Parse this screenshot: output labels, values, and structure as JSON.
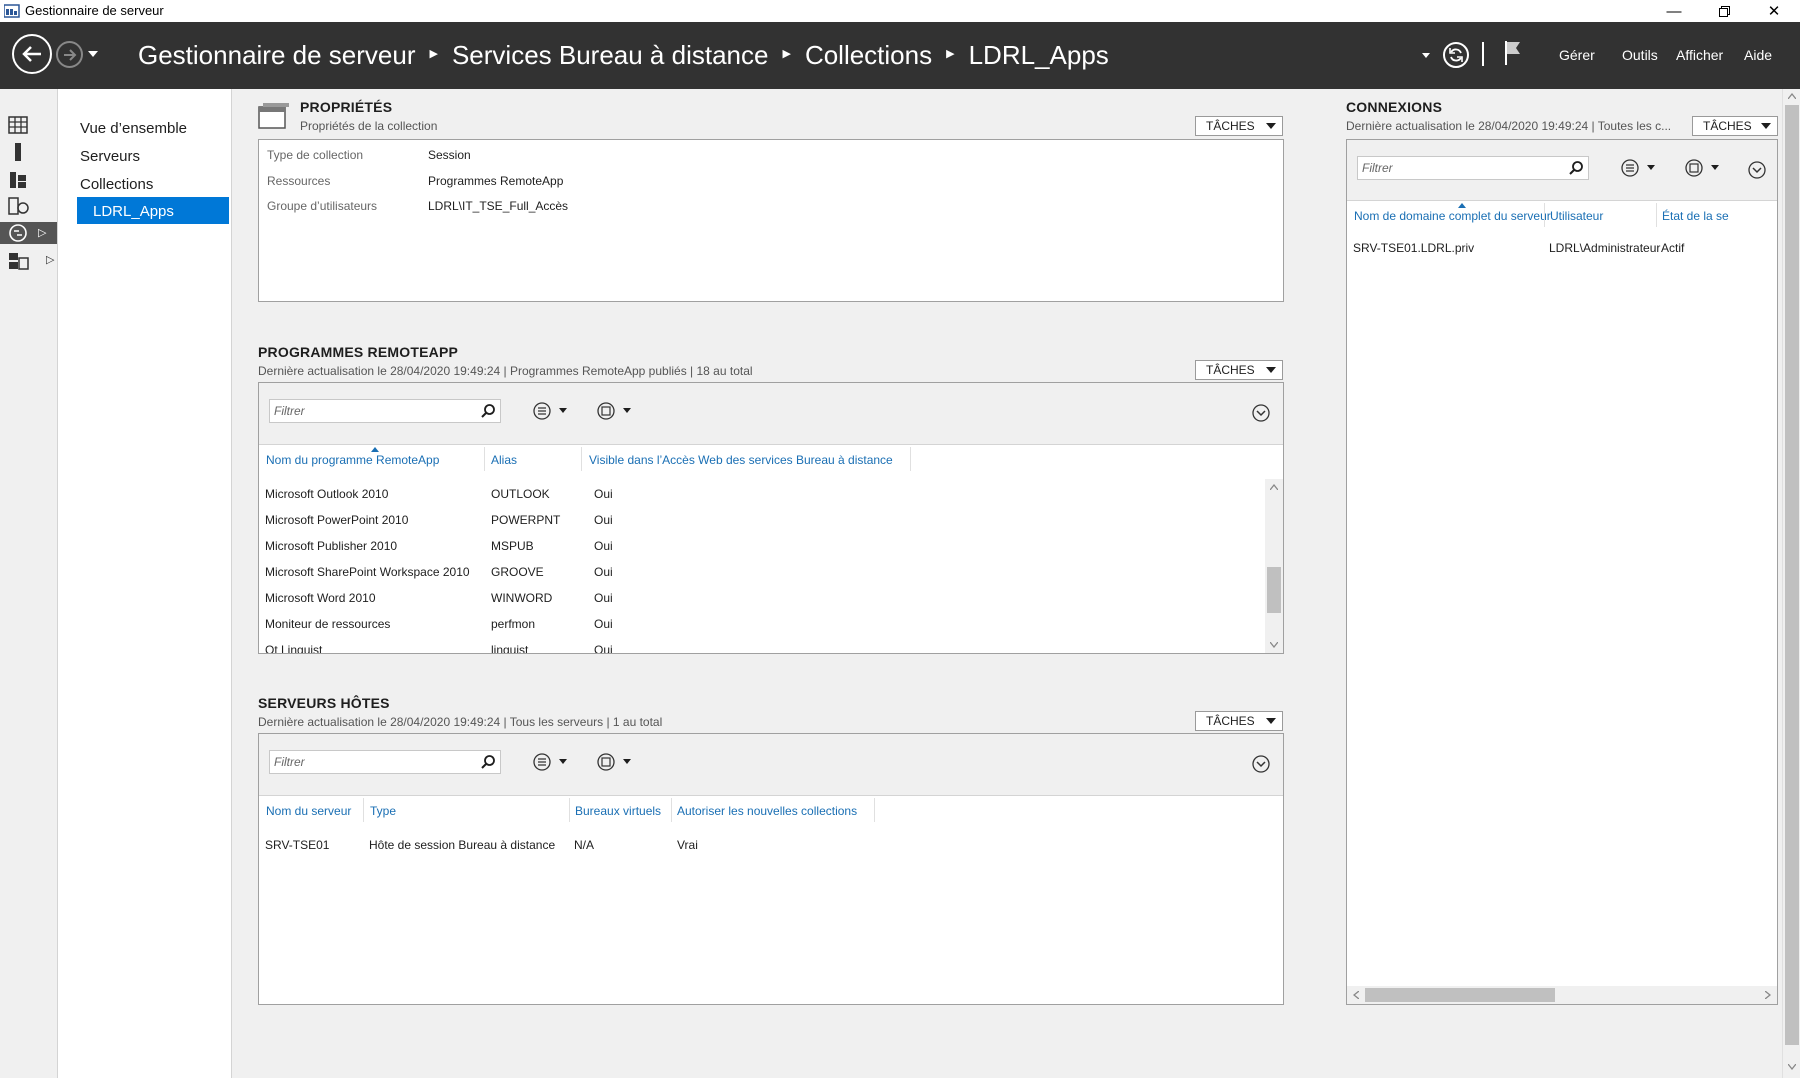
{
  "window": {
    "title": "Gestionnaire de serveur"
  },
  "header": {
    "breadcrumb": [
      "Gestionnaire de serveur",
      "Services Bureau à distance",
      "Collections",
      "LDRL_Apps"
    ],
    "menu": {
      "manage": "Gérer",
      "tools": "Outils",
      "view": "Afficher",
      "help": "Aide"
    }
  },
  "nav": {
    "items": [
      "Vue d’ensemble",
      "Serveurs",
      "Collections"
    ],
    "selected": "LDRL_Apps"
  },
  "tasks_label": "TÂCHES",
  "filter_placeholder": "Filtrer",
  "properties": {
    "title": "PROPRIÉTÉS",
    "subtitle": "Propriétés de la collection",
    "rows": [
      {
        "label": "Type de collection",
        "value": "Session"
      },
      {
        "label": "Ressources",
        "value": "Programmes RemoteApp"
      },
      {
        "label": "Groupe d’utilisateurs",
        "value": "LDRL\\IT_TSE_Full_Accès"
      }
    ]
  },
  "remoteapp": {
    "title": "PROGRAMMES REMOTEAPP",
    "subtitle": "Dernière actualisation le 28/04/2020 19:49:24 | Programmes RemoteApp publiés  | 18 au total",
    "columns": [
      "Nom du programme RemoteApp",
      "Alias",
      "Visible dans l’Accès Web des services Bureau à distance"
    ],
    "rows": [
      [
        "Microsoft Outlook 2010",
        "OUTLOOK",
        "Oui"
      ],
      [
        "Microsoft PowerPoint 2010",
        "POWERPNT",
        "Oui"
      ],
      [
        "Microsoft Publisher 2010",
        "MSPUB",
        "Oui"
      ],
      [
        "Microsoft SharePoint Workspace 2010",
        "GROOVE",
        "Oui"
      ],
      [
        "Microsoft Word 2010",
        "WINWORD",
        "Oui"
      ],
      [
        "Moniteur de ressources",
        "perfmon",
        "Oui"
      ],
      [
        "Qt Linguist",
        "linguist",
        "Oui"
      ]
    ]
  },
  "hosts": {
    "title": "SERVEURS HÔTES",
    "subtitle": "Dernière actualisation le 28/04/2020 19:49:24 | Tous les serveurs  | 1 au total",
    "columns": [
      "Nom du serveur",
      "Type",
      "Bureaux virtuels",
      "Autoriser les nouvelles collections"
    ],
    "rows": [
      [
        "SRV-TSE01",
        "Hôte de session Bureau à distance",
        "N/A",
        "Vrai"
      ]
    ]
  },
  "connections": {
    "title": "CONNEXIONS",
    "subtitle": "Dernière actualisation le 28/04/2020 19:49:24 | Toutes les c...",
    "columns": [
      "Nom de domaine complet du serveur",
      "Utilisateur",
      "État de la se"
    ],
    "rows": [
      [
        "SRV-TSE01.LDRL.priv",
        "LDRL\\Administrateur",
        "Actif"
      ]
    ]
  }
}
